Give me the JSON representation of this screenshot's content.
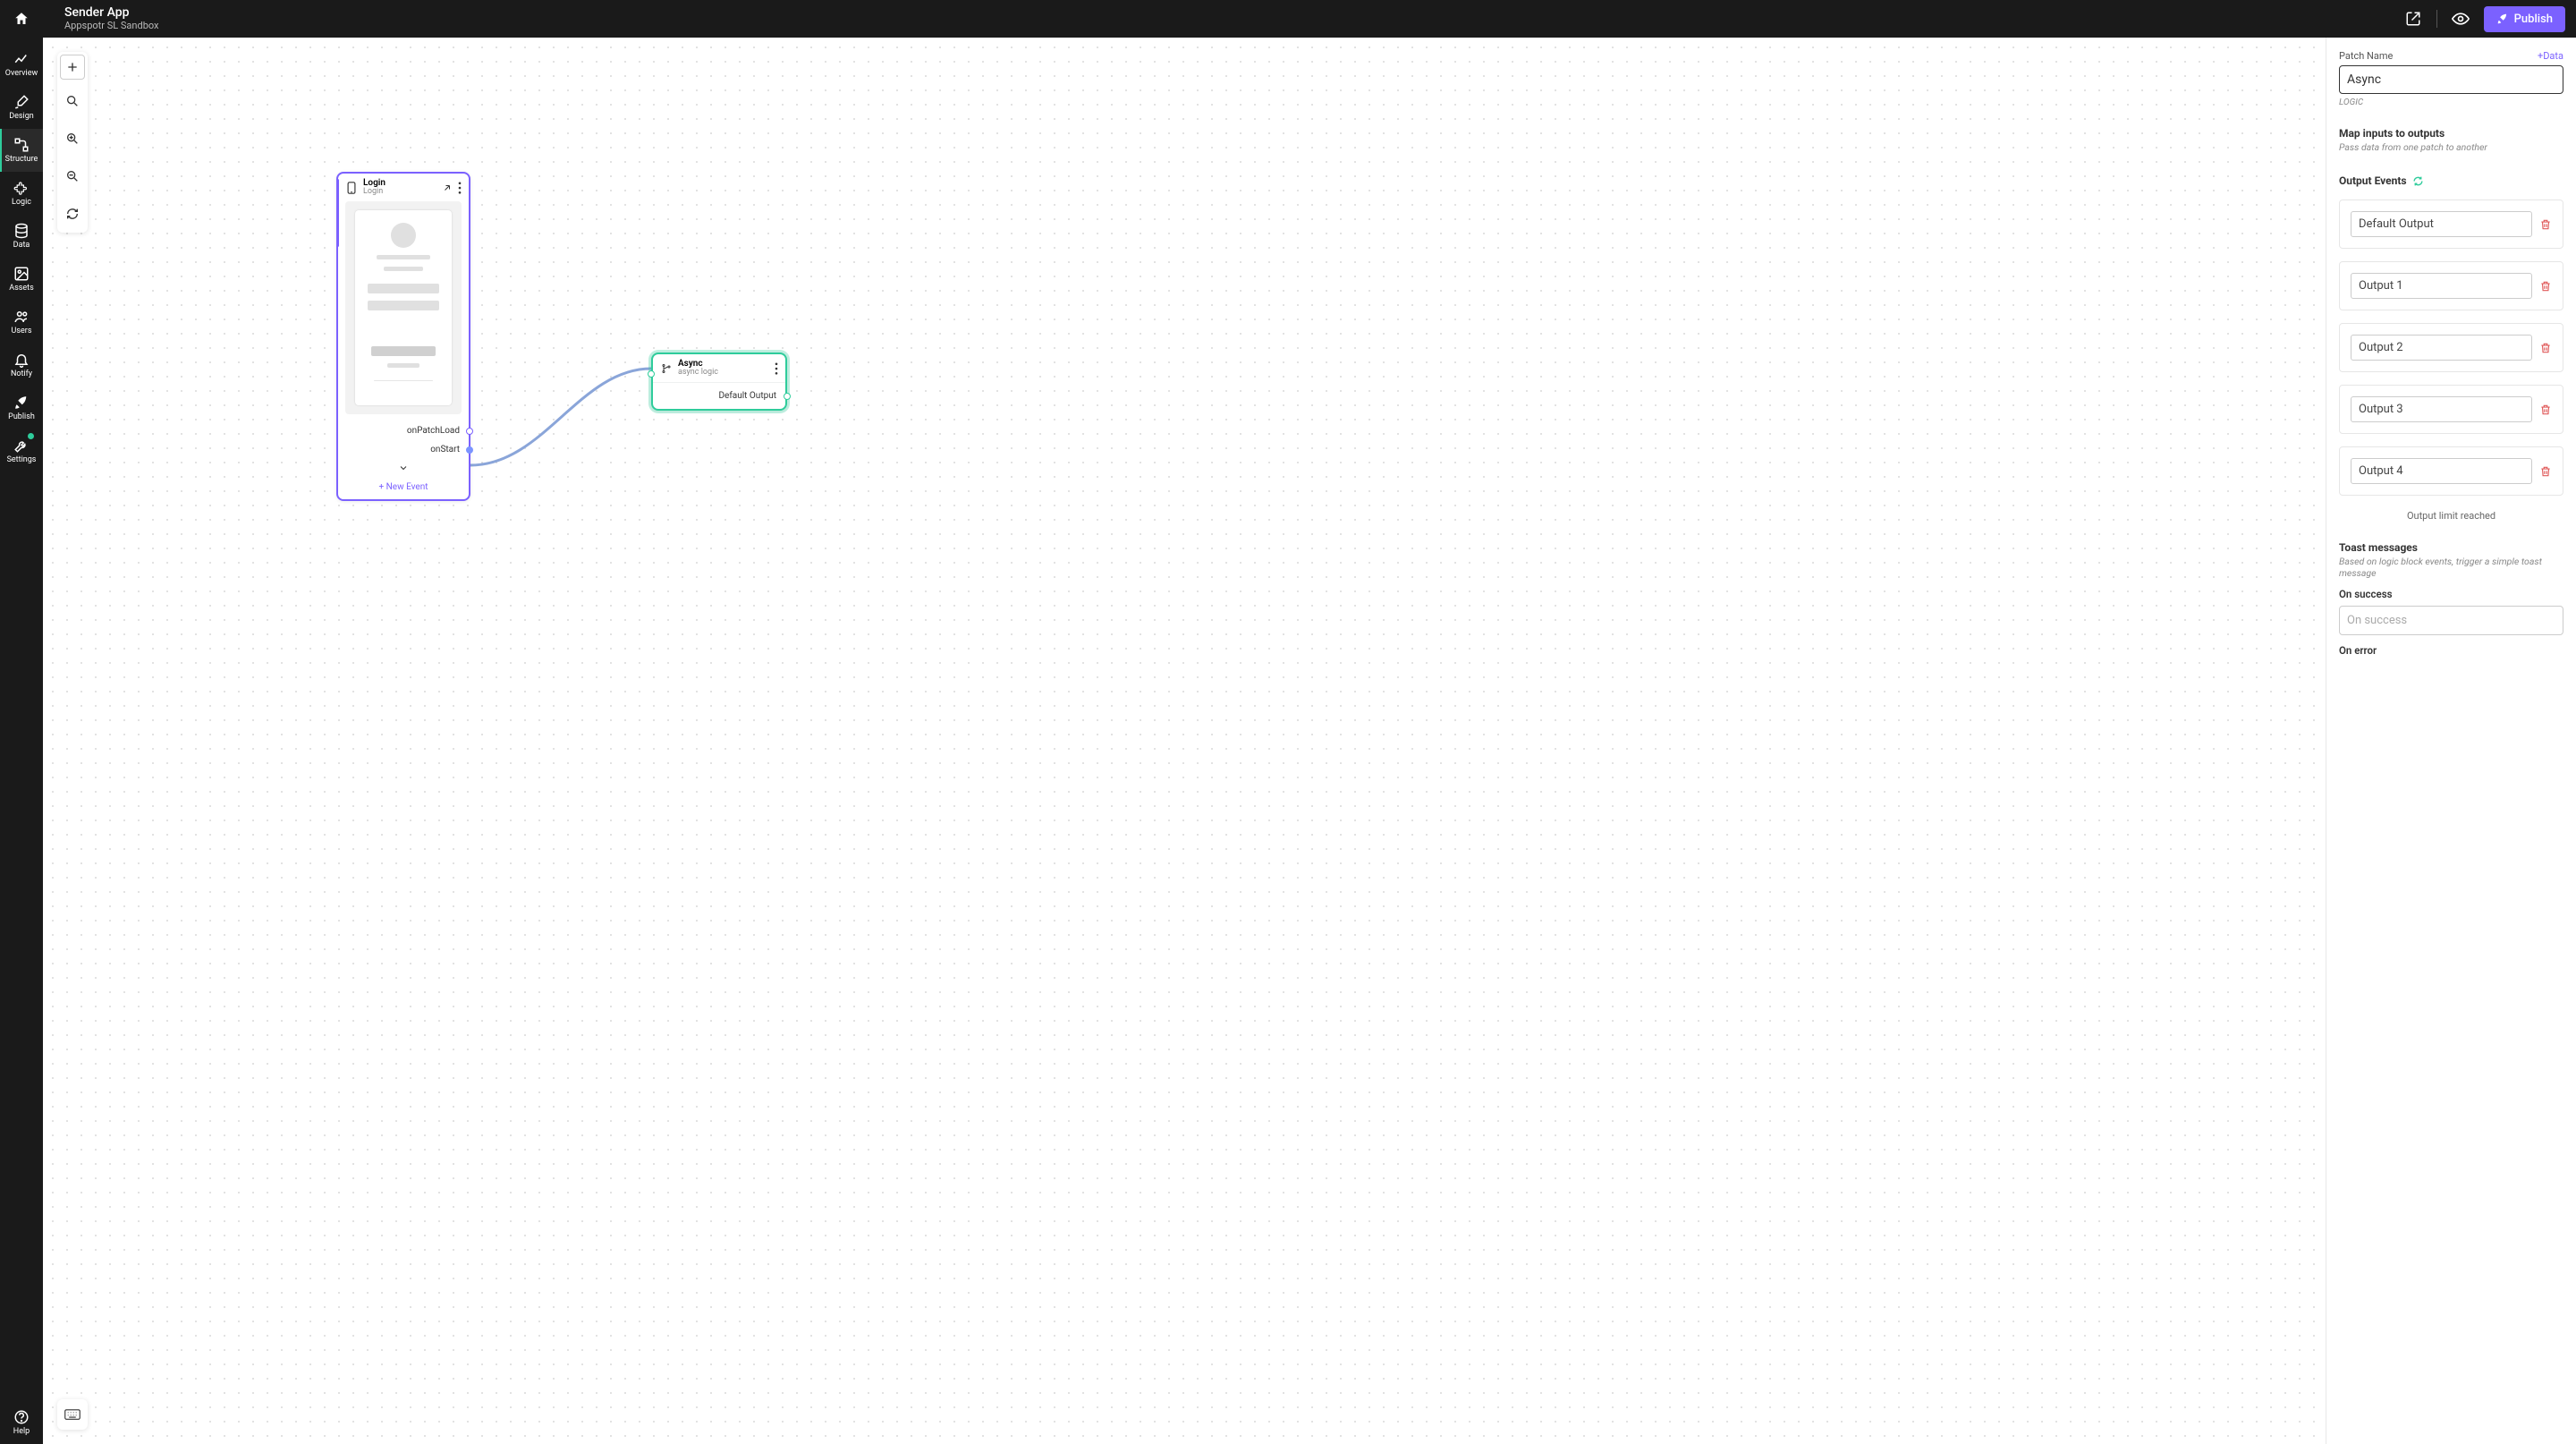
{
  "topbar": {
    "title": "Sender App",
    "subtitle": "Appspotr SL Sandbox",
    "publish_label": "Publish"
  },
  "sidebar": {
    "items": [
      {
        "label": "Overview"
      },
      {
        "label": "Design"
      },
      {
        "label": "Structure"
      },
      {
        "label": "Logic"
      },
      {
        "label": "Data"
      },
      {
        "label": "Assets"
      },
      {
        "label": "Users"
      },
      {
        "label": "Notify"
      },
      {
        "label": "Publish"
      },
      {
        "label": "Settings"
      }
    ],
    "help_label": "Help"
  },
  "canvas": {
    "login_node": {
      "title": "Login",
      "subtitle": "Login",
      "events": [
        {
          "label": "onPatchLoad"
        },
        {
          "label": "onStart"
        }
      ],
      "new_event_label": "+ New Event"
    },
    "async_node": {
      "title": "Async",
      "subtitle": "async logic",
      "output_label": "Default Output"
    }
  },
  "rightpanel": {
    "patch_name_label": "Patch Name",
    "add_data_label": "+Data",
    "patch_name_value": "Async",
    "kind_label": "LOGIC",
    "map_title": "Map inputs to outputs",
    "map_sub": "Pass data from one patch to another",
    "output_events_label": "Output Events",
    "outputs": [
      "Default Output",
      "Output 1",
      "Output 2",
      "Output 3",
      "Output 4"
    ],
    "limit_msg": "Output limit reached",
    "toast_title": "Toast messages",
    "toast_sub": "Based on logic block events, trigger a simple toast message",
    "on_success_label": "On success",
    "on_success_placeholder": "On success",
    "on_error_label": "On error"
  }
}
